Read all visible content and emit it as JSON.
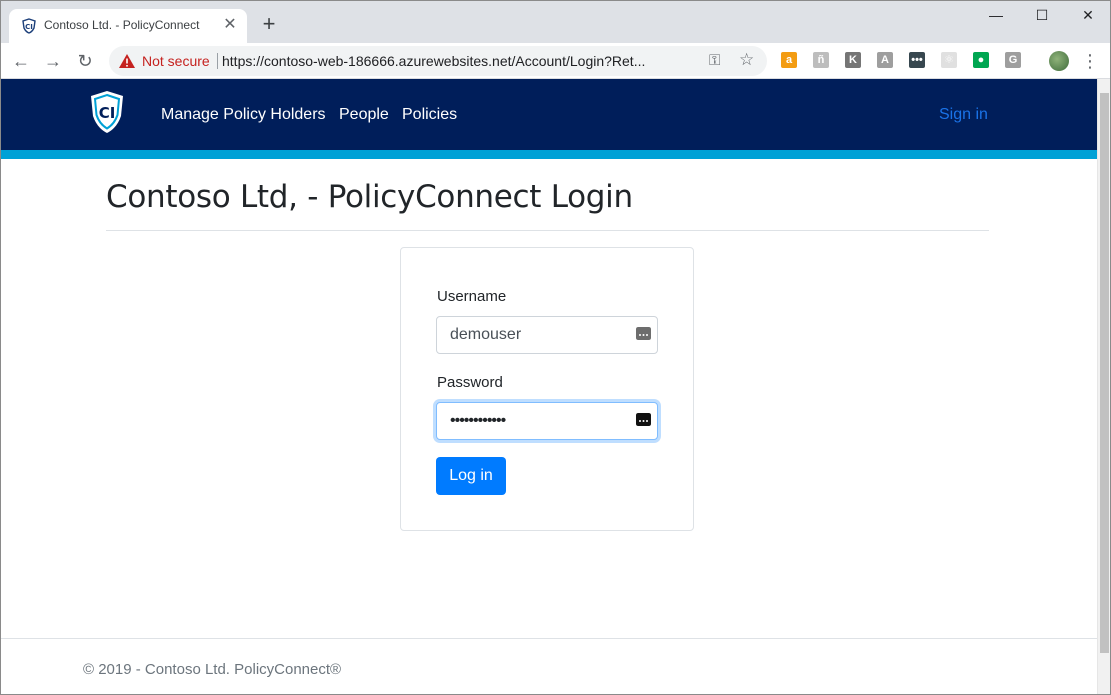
{
  "browser": {
    "tab_title": "Contoso Ltd. - PolicyConnect",
    "tab_close": "✕",
    "new_tab": "+",
    "window_controls": {
      "minimize": "—",
      "maximize": "☐",
      "close": "✕"
    },
    "security_label": "Not secure",
    "url": "https://contoso-web-186666.azurewebsites.net/Account/Login?Ret...",
    "extensions": [
      {
        "name": "amazon-extension-icon",
        "glyph": "a",
        "color": "#f39c12"
      },
      {
        "name": "extension-2-icon",
        "glyph": "ñ",
        "color": "#bdbdbd"
      },
      {
        "name": "k-extension-icon",
        "glyph": "K",
        "color": "#757575"
      },
      {
        "name": "angular-extension-icon",
        "glyph": "A",
        "color": "#9e9e9e"
      },
      {
        "name": "dots-extension-icon",
        "glyph": "•••",
        "color": "#37474f"
      },
      {
        "name": "react-extension-icon",
        "glyph": "⚛",
        "color": "#e0e0e0"
      },
      {
        "name": "green-leaf-extension-icon",
        "glyph": "●",
        "color": "#00a651"
      },
      {
        "name": "g-extension-icon",
        "glyph": "G",
        "color": "#9e9e9e"
      }
    ]
  },
  "navbar": {
    "links": [
      "Manage Policy Holders",
      "People",
      "Policies"
    ],
    "sign_in": "Sign in",
    "bg_color": "#001e5a",
    "stripe_color": "#00a1d6"
  },
  "page": {
    "title": "Contoso Ltd, - PolicyConnect Login"
  },
  "login": {
    "username_label": "Username",
    "username_value": "demouser",
    "password_label": "Password",
    "password_masked": "••••••••••••",
    "submit_label": "Log in",
    "button_color": "#007bff"
  },
  "footer": {
    "text": "© 2019 - Contoso Ltd. PolicyConnect®"
  }
}
